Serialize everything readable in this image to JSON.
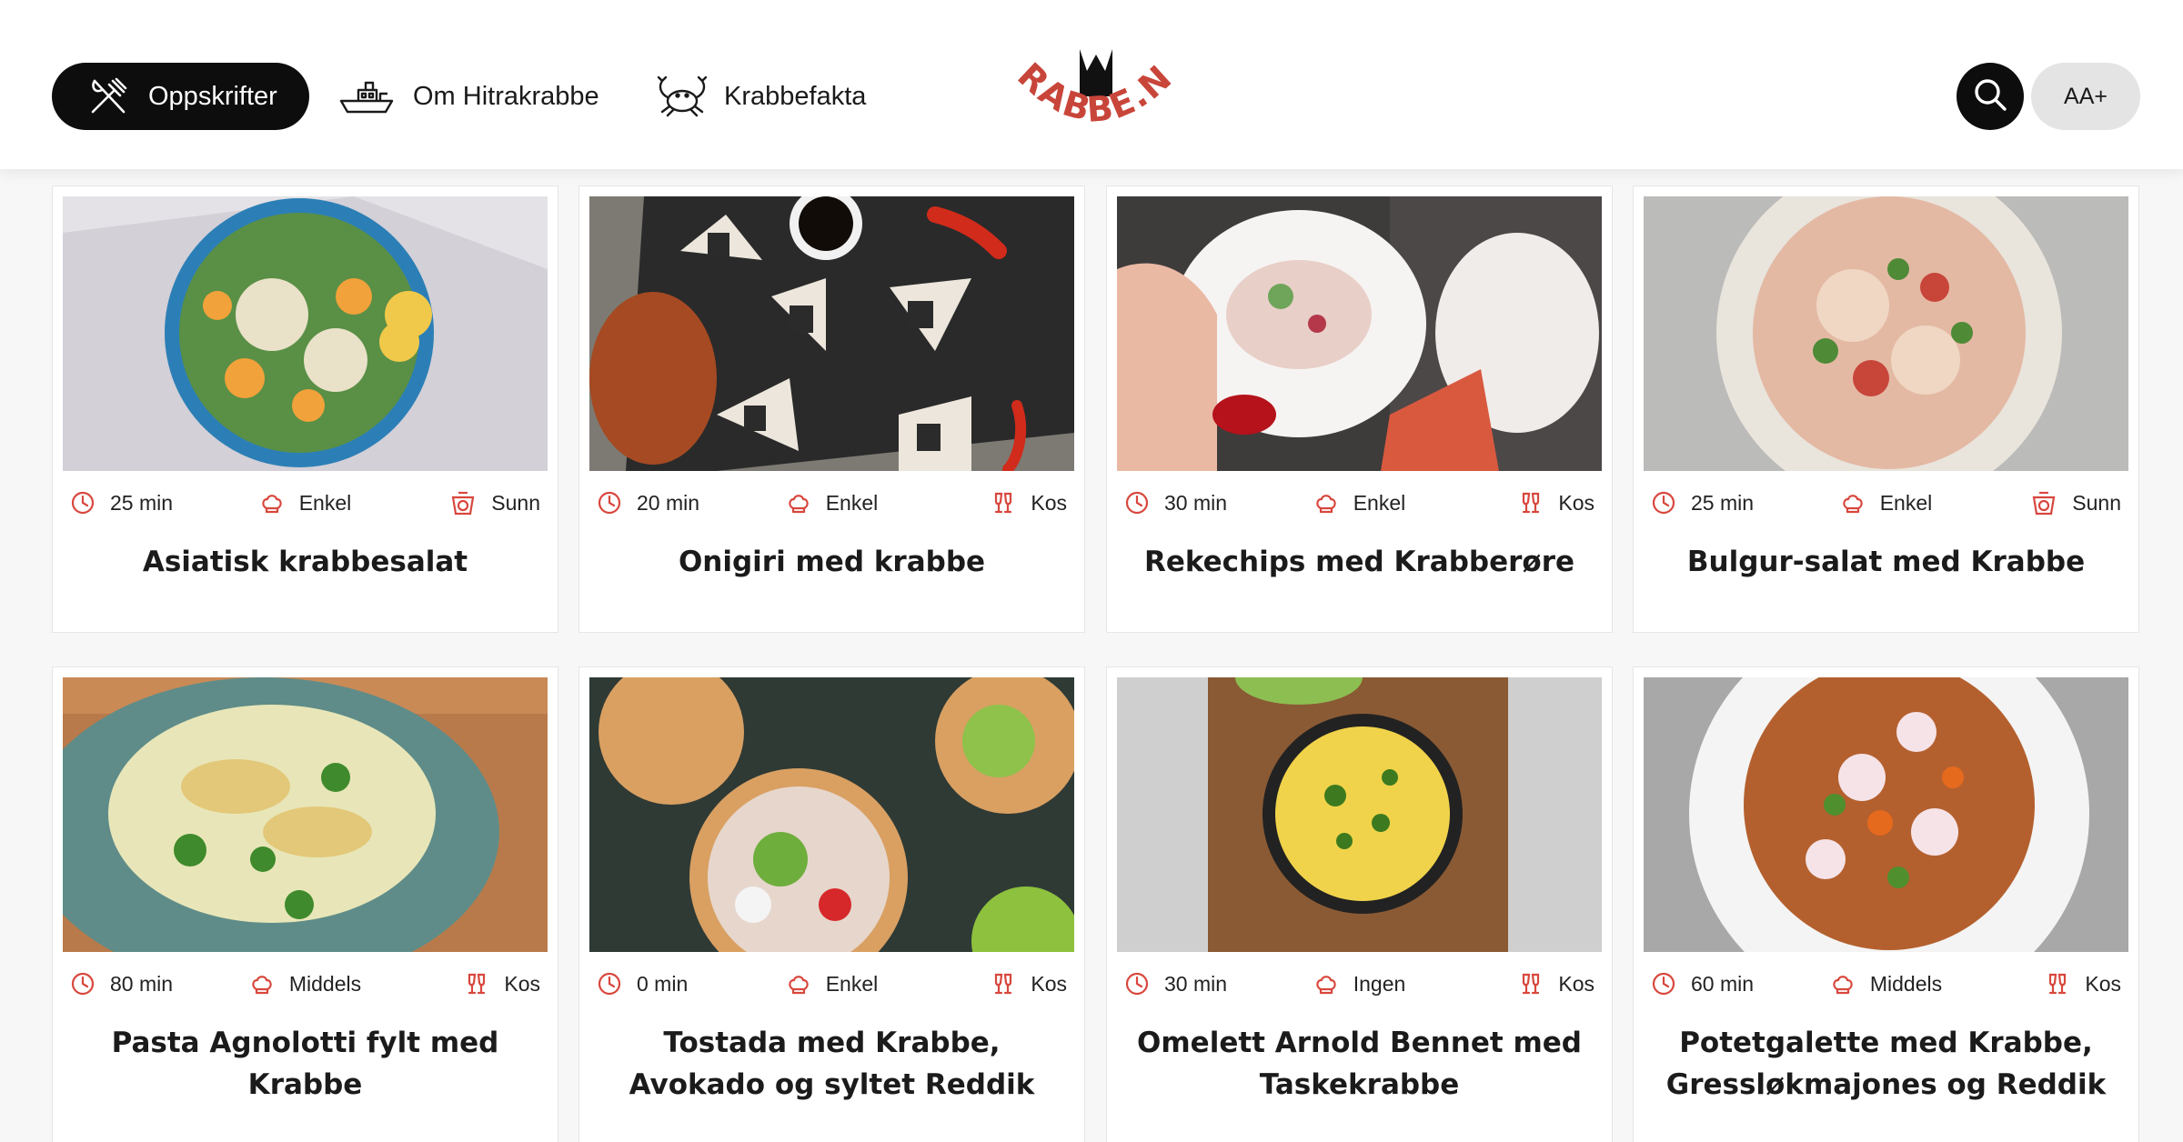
{
  "nav": {
    "recipes_label": "Oppskrifter",
    "about_label": "Om Hitrakrabbe",
    "facts_label": "Krabbefakta"
  },
  "logo": {
    "text": "KRABBE.NO"
  },
  "colors": {
    "brand_red": "#c8453a",
    "dark": "#0d0d0d",
    "accent": "#d8473d"
  },
  "font_button_label": "AA+",
  "icons": {
    "time": "clock-icon",
    "difficulty": "chef-hat-icon",
    "healthy": "scale-icon",
    "cozy": "glasses-icon"
  },
  "recipes": [
    {
      "time": "25 min",
      "difficulty": "Enkel",
      "category": "Sunn",
      "title": "Asiatisk krabbesalat"
    },
    {
      "time": "20 min",
      "difficulty": "Enkel",
      "category": "Kos",
      "title": "Onigiri med krabbe"
    },
    {
      "time": "30 min",
      "difficulty": "Enkel",
      "category": "Kos",
      "title": "Rekechips med Krabberøre"
    },
    {
      "time": "25 min",
      "difficulty": "Enkel",
      "category": "Sunn",
      "title": "Bulgur-salat med Krabbe"
    },
    {
      "time": "80 min",
      "difficulty": "Middels",
      "category": "Kos",
      "title": "Pasta Agnolotti fylt med Krabbe"
    },
    {
      "time": "0 min",
      "difficulty": "Enkel",
      "category": "Kos",
      "title": "Tostada med Krabbe, Avokado og syltet Reddik"
    },
    {
      "time": "30 min",
      "difficulty": "Ingen",
      "category": "Kos",
      "title": "Omelett Arnold Bennet med Taskekrabbe"
    },
    {
      "time": "60 min",
      "difficulty": "Middels",
      "category": "Kos",
      "title": "Potetgalette med Krabbe, Gressløkmajones og Reddik"
    }
  ]
}
